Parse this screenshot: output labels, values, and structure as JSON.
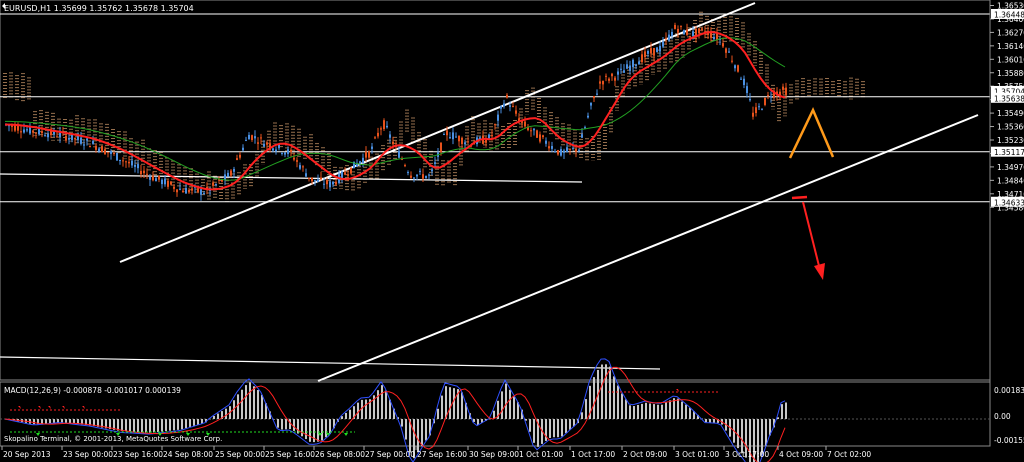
{
  "window": {
    "symbol_header": "EURUSD,H1  1.35699 1.35762 1.35678 1.35704"
  },
  "indicator": {
    "macd_header": "MACD(12,26,9) -0.000878 -0.001017 0.000139",
    "copyright": "Skopalino Terminal, © 2001-2013, MetaQuotes Software Corp.",
    "scale_labels": [
      "0.001832",
      "0.00",
      "-0.001551"
    ],
    "scale_values": [
      0.001832,
      0.0,
      -0.001551
    ]
  },
  "colors": {
    "background": "#000000",
    "bull_candle": "#4a90e2",
    "bear_candle": "#e8521c",
    "channel_lines": "#ffffff",
    "cloud": "#d8a070",
    "ma_red": "#ff2020",
    "ma_green": "#22a022",
    "forecast_orange": "#ff9a1a",
    "forecast_red": "#ff2020",
    "macd_line": "#3050ff",
    "signal_line": "#ff2020",
    "histogram": "#c8c8c8",
    "markers_red": "#ff2020",
    "markers_green": "#22dd22"
  },
  "chart_data": {
    "type": "candlestick",
    "symbol": "EURUSD",
    "timeframe": "H1",
    "ohlc_last": {
      "open": 1.35699,
      "high": 1.35762,
      "low": 1.35678,
      "close": 1.35704
    },
    "ylim": [
      1.4558,
      1.3656
    ],
    "yticks": [
      1.3653,
      1.364,
      1.3627,
      1.3614,
      1.3601,
      1.3588,
      1.3575,
      1.3562,
      1.3549,
      1.3536,
      1.3523,
      1.351,
      1.3497,
      1.3484,
      1.3471,
      1.3458
    ],
    "ytick_labels": [
      "1.36530",
      "1.36400",
      "1.36270",
      "1.36140",
      "1.36010",
      "1.35880",
      "1.35750",
      "1.35620",
      "1.35490",
      "1.35360",
      "1.35230",
      "1.35100",
      "1.34970",
      "1.34840",
      "1.34710",
      "1.34580"
    ],
    "price_boxes": [
      {
        "label": "1.36448",
        "value": 1.36448
      },
      {
        "label": "1.35704",
        "value": 1.35704
      },
      {
        "label": "1.35638",
        "value": 1.35638
      },
      {
        "label": "1.35117",
        "value": 1.35117
      },
      {
        "label": "1.34633",
        "value": 1.34633
      }
    ],
    "xtick_labels": [
      "20 Sep 2013",
      "23 Sep 00:00",
      "23 Sep 16:00",
      "24 Sep 08:00",
      "25 Sep 00:00",
      "25 Sep 16:00",
      "26 Sep 08:00",
      "27 Sep 00:00",
      "27 Sep 16:00",
      "30 Sep 09:00",
      "1 Oct 01:00",
      "1 Oct 17:00",
      "2 Oct 09:00",
      "3 Oct 01:00",
      "3 Oct 17:00",
      "4 Oct 09:00",
      "7 Oct 02:00"
    ],
    "horizontal_levels": [
      1.36448,
      1.35638,
      1.35117,
      1.34633
    ]
  }
}
